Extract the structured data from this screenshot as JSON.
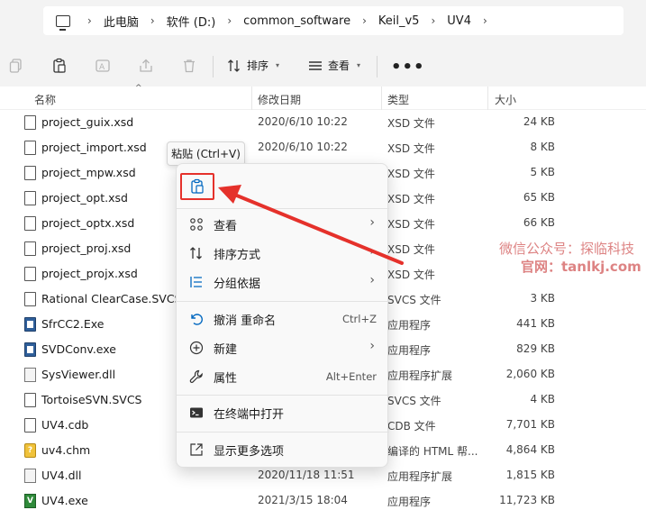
{
  "breadcrumb": {
    "items": [
      "此电脑",
      "软件 (D:)",
      "common_software",
      "Keil_v5",
      "UV4"
    ],
    "separator": "›"
  },
  "toolbar": {
    "sort_label": "排序",
    "view_label": "查看",
    "more_label": "•••"
  },
  "columns": {
    "name": "名称",
    "date": "修改日期",
    "type": "类型",
    "size": "大小"
  },
  "files": [
    {
      "name": "project_guix.xsd",
      "date": "2020/6/10 10:22",
      "type": "XSD 文件",
      "size": "24 KB",
      "icon": "doc-icon"
    },
    {
      "name": "project_import.xsd",
      "date": "2020/6/10 10:22",
      "type": "XSD 文件",
      "size": "8 KB",
      "icon": "doc-icon"
    },
    {
      "name": "project_mpw.xsd",
      "date": "",
      "type": "XSD 文件",
      "size": "5 KB",
      "icon": "doc-icon"
    },
    {
      "name": "project_opt.xsd",
      "date": "",
      "type": "XSD 文件",
      "size": "65 KB",
      "icon": "doc-icon"
    },
    {
      "name": "project_optx.xsd",
      "date": "",
      "type": "XSD 文件",
      "size": "66 KB",
      "icon": "doc-icon"
    },
    {
      "name": "project_proj.xsd",
      "date": "",
      "type": "XSD 文件",
      "size": "",
      "icon": "doc-icon"
    },
    {
      "name": "project_projx.xsd",
      "date": "",
      "type": "XSD 文件",
      "size": "",
      "icon": "doc-icon"
    },
    {
      "name": "Rational ClearCase.SVCS",
      "date": "",
      "type": "SVCS 文件",
      "size": "3 KB",
      "icon": "doc-icon"
    },
    {
      "name": "SfrCC2.Exe",
      "date": "",
      "type": "应用程序",
      "size": "441 KB",
      "icon": "exe-icon"
    },
    {
      "name": "SVDConv.exe",
      "date": "",
      "type": "应用程序",
      "size": "829 KB",
      "icon": "exe-icon"
    },
    {
      "name": "SysViewer.dll",
      "date": "",
      "type": "应用程序扩展",
      "size": "2,060 KB",
      "icon": "dll-icon"
    },
    {
      "name": "TortoiseSVN.SVCS",
      "date": "",
      "type": "SVCS 文件",
      "size": "4 KB",
      "icon": "doc-icon"
    },
    {
      "name": "UV4.cdb",
      "date": "",
      "type": "CDB 文件",
      "size": "7,701 KB",
      "icon": "doc-icon"
    },
    {
      "name": "uv4.chm",
      "date": "",
      "type": "编译的 HTML 帮...",
      "size": "4,864 KB",
      "icon": "chm-icon"
    },
    {
      "name": "UV4.dll",
      "date": "2020/11/18 11:51",
      "type": "应用程序扩展",
      "size": "1,815 KB",
      "icon": "dll-icon"
    },
    {
      "name": "UV4.exe",
      "date": "2021/3/15 18:04",
      "type": "应用程序",
      "size": "11,723 KB",
      "icon": "uv4-icon"
    }
  ],
  "tooltip": {
    "text": "粘贴 (Ctrl+V)"
  },
  "context_menu": {
    "view": "查看",
    "sort": "排序方式",
    "group": "分组依据",
    "undo": "撤消 重命名",
    "undo_shortcut": "Ctrl+Z",
    "new": "新建",
    "properties": "属性",
    "properties_shortcut": "Alt+Enter",
    "terminal": "在终端中打开",
    "more_options": "显示更多选项"
  },
  "watermark": {
    "line1": "微信公众号：探临科技",
    "line2": "官网：tanlkj.com"
  },
  "colors": {
    "highlight_red": "#e5312b",
    "accent_blue": "#0067c0"
  }
}
